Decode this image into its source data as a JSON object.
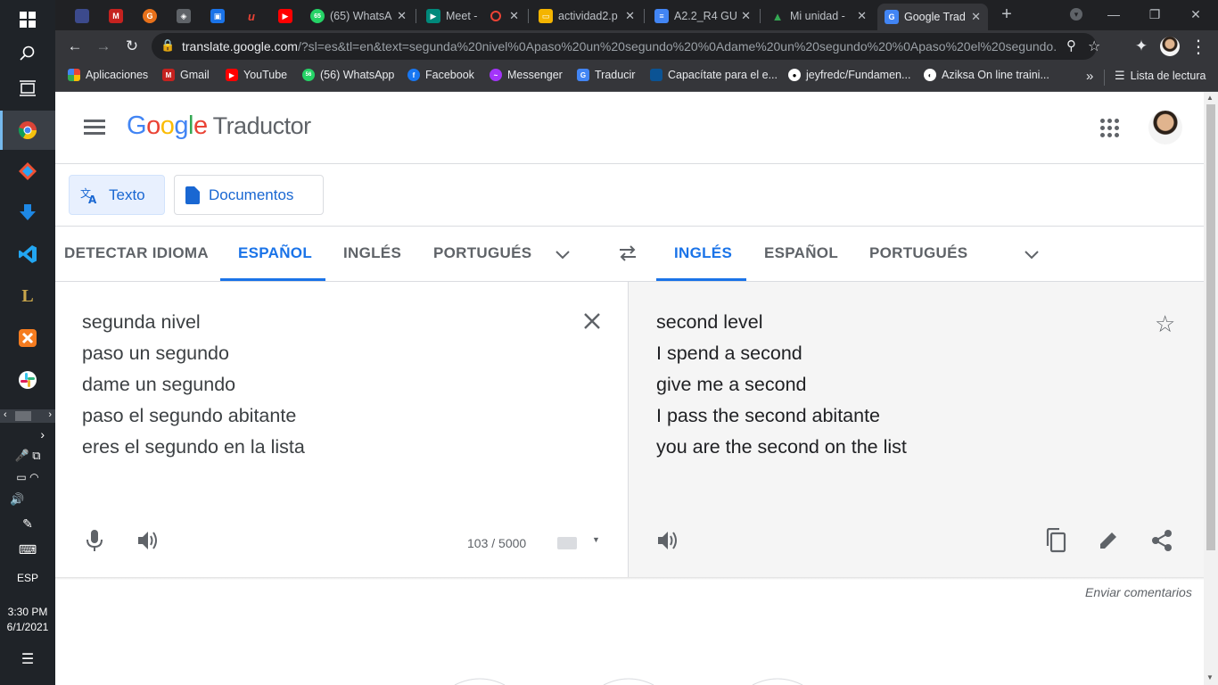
{
  "taskbar": {
    "language": "ESP",
    "time": "3:30 PM",
    "date": "6/1/2021"
  },
  "browser": {
    "tabs": [
      {
        "label": "",
        "color": "#3c4a8c"
      },
      {
        "label": "",
        "color": "#c5221f",
        "glyph": "M"
      },
      {
        "label": "",
        "color": "#e8711a",
        "glyph": "G"
      },
      {
        "label": "",
        "color": "#5f6368",
        "glyph": "◈"
      },
      {
        "label": "",
        "color": "#1a73e8",
        "glyph": "▣"
      },
      {
        "label": "",
        "color": "#c5221f",
        "glyph": "u"
      },
      {
        "label": "",
        "color": "#ff0000",
        "glyph": "▶"
      },
      {
        "label": "(65) WhatsA",
        "color": "#25d366",
        "glyph": "65"
      },
      {
        "label": "Meet -",
        "color": "#00897b",
        "glyph": "▶"
      },
      {
        "label": "actividad2.p",
        "color": "#f4b400",
        "glyph": "▭"
      },
      {
        "label": "A2.2_R4 GU",
        "color": "#4285f4",
        "glyph": "≡"
      },
      {
        "label": "Mi unidad -",
        "color": "#34a853",
        "glyph": "▲"
      },
      {
        "label": "Google Trad",
        "color": "#4285f4",
        "glyph": "G"
      }
    ],
    "url_host": "translate.google.com",
    "url_path": "/?sl=es&tl=en&text=segunda%20nivel%0Apaso%20un%20segundo%20%0Adame%20un%20segundo%20%0Apaso%20el%20segundo...",
    "bookmarks": [
      {
        "label": "Aplicaciones",
        "color": "#ea4335"
      },
      {
        "label": "Gmail",
        "color": "#c5221f"
      },
      {
        "label": "YouTube",
        "color": "#ff0000"
      },
      {
        "label": "(56) WhatsApp",
        "color": "#25d366"
      },
      {
        "label": "Facebook",
        "color": "#1877f2"
      },
      {
        "label": "Messenger",
        "color": "#a334fa"
      },
      {
        "label": "Traducir",
        "color": "#4285f4"
      },
      {
        "label": "Capacítate para el e...",
        "color": "#0b5394"
      },
      {
        "label": "jeyfredc/Fundamen...",
        "color": "#ffffff"
      },
      {
        "label": "Aziksa On line traini...",
        "color": "#ffffff"
      }
    ],
    "more_bookmarks": "»",
    "reading_list": "Lista de lectura"
  },
  "translate": {
    "product_name": "Traductor",
    "modes": {
      "text": "Texto",
      "documents": "Documentos"
    },
    "source_langs": [
      "DETECTAR IDIOMA",
      "ESPAÑOL",
      "INGLÉS",
      "PORTUGUÉS"
    ],
    "target_langs": [
      "INGLÉS",
      "ESPAÑOL",
      "PORTUGUÉS"
    ],
    "source_text": "segunda nivel\npaso un segundo\ndame un segundo\npaso el segundo abitante\neres el segundo en la lista",
    "target_text": "second level\nI spend a second\ngive me a second\nI pass the second abitante\nyou are the second on the list",
    "char_count": "103 / 5000",
    "feedback": "Enviar comentarios"
  }
}
